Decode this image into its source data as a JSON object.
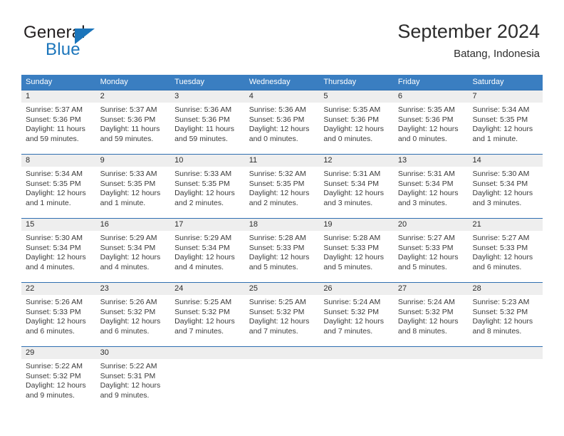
{
  "brand": {
    "name_top": "General",
    "name_bottom": "Blue",
    "accent_color": "#1b75bb"
  },
  "header": {
    "title": "September 2024",
    "subtitle": "Batang, Indonesia"
  },
  "theme": {
    "header_row_bg": "#3a7ec1",
    "week_divider": "#2f6fb0",
    "daynum_band_bg": "#eeeeee",
    "text_color": "#3b3b3b"
  },
  "weekdays": [
    "Sunday",
    "Monday",
    "Tuesday",
    "Wednesday",
    "Thursday",
    "Friday",
    "Saturday"
  ],
  "weeks": [
    {
      "daynums": [
        "1",
        "2",
        "3",
        "4",
        "5",
        "6",
        "7"
      ],
      "cells": [
        {
          "sunrise": "Sunrise: 5:37 AM",
          "sunset": "Sunset: 5:36 PM",
          "daylight1": "Daylight: 11 hours",
          "daylight2": "and 59 minutes."
        },
        {
          "sunrise": "Sunrise: 5:37 AM",
          "sunset": "Sunset: 5:36 PM",
          "daylight1": "Daylight: 11 hours",
          "daylight2": "and 59 minutes."
        },
        {
          "sunrise": "Sunrise: 5:36 AM",
          "sunset": "Sunset: 5:36 PM",
          "daylight1": "Daylight: 11 hours",
          "daylight2": "and 59 minutes."
        },
        {
          "sunrise": "Sunrise: 5:36 AM",
          "sunset": "Sunset: 5:36 PM",
          "daylight1": "Daylight: 12 hours",
          "daylight2": "and 0 minutes."
        },
        {
          "sunrise": "Sunrise: 5:35 AM",
          "sunset": "Sunset: 5:36 PM",
          "daylight1": "Daylight: 12 hours",
          "daylight2": "and 0 minutes."
        },
        {
          "sunrise": "Sunrise: 5:35 AM",
          "sunset": "Sunset: 5:36 PM",
          "daylight1": "Daylight: 12 hours",
          "daylight2": "and 0 minutes."
        },
        {
          "sunrise": "Sunrise: 5:34 AM",
          "sunset": "Sunset: 5:35 PM",
          "daylight1": "Daylight: 12 hours",
          "daylight2": "and 1 minute."
        }
      ]
    },
    {
      "daynums": [
        "8",
        "9",
        "10",
        "11",
        "12",
        "13",
        "14"
      ],
      "cells": [
        {
          "sunrise": "Sunrise: 5:34 AM",
          "sunset": "Sunset: 5:35 PM",
          "daylight1": "Daylight: 12 hours",
          "daylight2": "and 1 minute."
        },
        {
          "sunrise": "Sunrise: 5:33 AM",
          "sunset": "Sunset: 5:35 PM",
          "daylight1": "Daylight: 12 hours",
          "daylight2": "and 1 minute."
        },
        {
          "sunrise": "Sunrise: 5:33 AM",
          "sunset": "Sunset: 5:35 PM",
          "daylight1": "Daylight: 12 hours",
          "daylight2": "and 2 minutes."
        },
        {
          "sunrise": "Sunrise: 5:32 AM",
          "sunset": "Sunset: 5:35 PM",
          "daylight1": "Daylight: 12 hours",
          "daylight2": "and 2 minutes."
        },
        {
          "sunrise": "Sunrise: 5:31 AM",
          "sunset": "Sunset: 5:34 PM",
          "daylight1": "Daylight: 12 hours",
          "daylight2": "and 3 minutes."
        },
        {
          "sunrise": "Sunrise: 5:31 AM",
          "sunset": "Sunset: 5:34 PM",
          "daylight1": "Daylight: 12 hours",
          "daylight2": "and 3 minutes."
        },
        {
          "sunrise": "Sunrise: 5:30 AM",
          "sunset": "Sunset: 5:34 PM",
          "daylight1": "Daylight: 12 hours",
          "daylight2": "and 3 minutes."
        }
      ]
    },
    {
      "daynums": [
        "15",
        "16",
        "17",
        "18",
        "19",
        "20",
        "21"
      ],
      "cells": [
        {
          "sunrise": "Sunrise: 5:30 AM",
          "sunset": "Sunset: 5:34 PM",
          "daylight1": "Daylight: 12 hours",
          "daylight2": "and 4 minutes."
        },
        {
          "sunrise": "Sunrise: 5:29 AM",
          "sunset": "Sunset: 5:34 PM",
          "daylight1": "Daylight: 12 hours",
          "daylight2": "and 4 minutes."
        },
        {
          "sunrise": "Sunrise: 5:29 AM",
          "sunset": "Sunset: 5:34 PM",
          "daylight1": "Daylight: 12 hours",
          "daylight2": "and 4 minutes."
        },
        {
          "sunrise": "Sunrise: 5:28 AM",
          "sunset": "Sunset: 5:33 PM",
          "daylight1": "Daylight: 12 hours",
          "daylight2": "and 5 minutes."
        },
        {
          "sunrise": "Sunrise: 5:28 AM",
          "sunset": "Sunset: 5:33 PM",
          "daylight1": "Daylight: 12 hours",
          "daylight2": "and 5 minutes."
        },
        {
          "sunrise": "Sunrise: 5:27 AM",
          "sunset": "Sunset: 5:33 PM",
          "daylight1": "Daylight: 12 hours",
          "daylight2": "and 5 minutes."
        },
        {
          "sunrise": "Sunrise: 5:27 AM",
          "sunset": "Sunset: 5:33 PM",
          "daylight1": "Daylight: 12 hours",
          "daylight2": "and 6 minutes."
        }
      ]
    },
    {
      "daynums": [
        "22",
        "23",
        "24",
        "25",
        "26",
        "27",
        "28"
      ],
      "cells": [
        {
          "sunrise": "Sunrise: 5:26 AM",
          "sunset": "Sunset: 5:33 PM",
          "daylight1": "Daylight: 12 hours",
          "daylight2": "and 6 minutes."
        },
        {
          "sunrise": "Sunrise: 5:26 AM",
          "sunset": "Sunset: 5:32 PM",
          "daylight1": "Daylight: 12 hours",
          "daylight2": "and 6 minutes."
        },
        {
          "sunrise": "Sunrise: 5:25 AM",
          "sunset": "Sunset: 5:32 PM",
          "daylight1": "Daylight: 12 hours",
          "daylight2": "and 7 minutes."
        },
        {
          "sunrise": "Sunrise: 5:25 AM",
          "sunset": "Sunset: 5:32 PM",
          "daylight1": "Daylight: 12 hours",
          "daylight2": "and 7 minutes."
        },
        {
          "sunrise": "Sunrise: 5:24 AM",
          "sunset": "Sunset: 5:32 PM",
          "daylight1": "Daylight: 12 hours",
          "daylight2": "and 7 minutes."
        },
        {
          "sunrise": "Sunrise: 5:24 AM",
          "sunset": "Sunset: 5:32 PM",
          "daylight1": "Daylight: 12 hours",
          "daylight2": "and 8 minutes."
        },
        {
          "sunrise": "Sunrise: 5:23 AM",
          "sunset": "Sunset: 5:32 PM",
          "daylight1": "Daylight: 12 hours",
          "daylight2": "and 8 minutes."
        }
      ]
    },
    {
      "daynums": [
        "29",
        "30",
        "",
        "",
        "",
        "",
        ""
      ],
      "cells": [
        {
          "sunrise": "Sunrise: 5:22 AM",
          "sunset": "Sunset: 5:32 PM",
          "daylight1": "Daylight: 12 hours",
          "daylight2": "and 9 minutes."
        },
        {
          "sunrise": "Sunrise: 5:22 AM",
          "sunset": "Sunset: 5:31 PM",
          "daylight1": "Daylight: 12 hours",
          "daylight2": "and 9 minutes."
        },
        {
          "sunrise": "",
          "sunset": "",
          "daylight1": "",
          "daylight2": ""
        },
        {
          "sunrise": "",
          "sunset": "",
          "daylight1": "",
          "daylight2": ""
        },
        {
          "sunrise": "",
          "sunset": "",
          "daylight1": "",
          "daylight2": ""
        },
        {
          "sunrise": "",
          "sunset": "",
          "daylight1": "",
          "daylight2": ""
        },
        {
          "sunrise": "",
          "sunset": "",
          "daylight1": "",
          "daylight2": ""
        }
      ]
    }
  ]
}
